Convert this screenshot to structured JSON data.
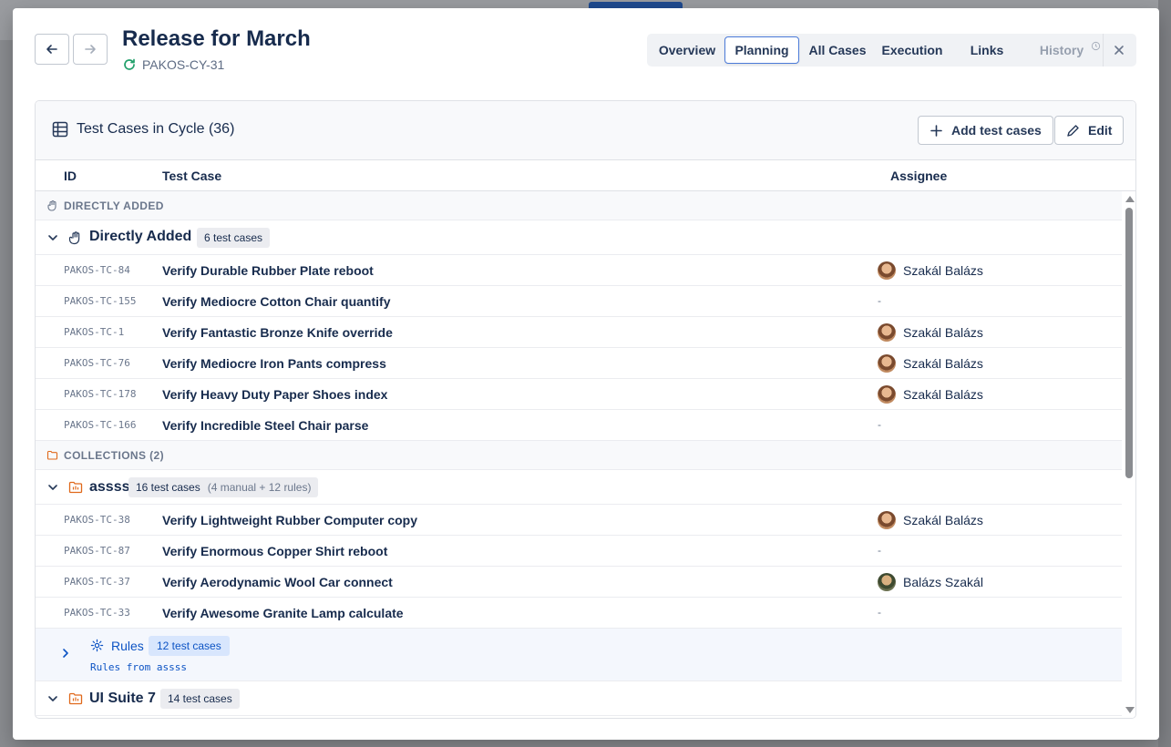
{
  "header": {
    "title": "Release for March",
    "cycle_key": "PAKOS-CY-31"
  },
  "tabs": [
    {
      "label": "Overview",
      "state": "normal"
    },
    {
      "label": "Planning",
      "state": "active"
    },
    {
      "label": "All Cases",
      "state": "normal"
    },
    {
      "label": "Execution",
      "state": "normal"
    },
    {
      "label": "Links",
      "state": "normal"
    },
    {
      "label": "History",
      "state": "disabled"
    }
  ],
  "panel": {
    "title": "Test Cases in Cycle (36)",
    "add_label": "Add test cases",
    "edit_label": "Edit"
  },
  "columns": {
    "id": "ID",
    "name": "Test Case",
    "assignee": "Assignee"
  },
  "sections": {
    "direct": "DIRECTLY ADDED",
    "collections": "COLLECTIONS (2)"
  },
  "direct_group": {
    "name": "Directly Added",
    "badge": "6 test cases",
    "cases": [
      {
        "id": "PAKOS-TC-84",
        "name": "Verify Durable Rubber Plate reboot",
        "assignee": "Szakál Balázs"
      },
      {
        "id": "PAKOS-TC-155",
        "name": "Verify Mediocre Cotton Chair quantify",
        "assignee": "-"
      },
      {
        "id": "PAKOS-TC-1",
        "name": "Verify Fantastic Bronze Knife override",
        "assignee": "Szakál Balázs"
      },
      {
        "id": "PAKOS-TC-76",
        "name": "Verify Mediocre Iron Pants compress",
        "assignee": "Szakál Balázs"
      },
      {
        "id": "PAKOS-TC-178",
        "name": "Verify Heavy Duty Paper Shoes index",
        "assignee": "Szakál Balázs"
      },
      {
        "id": "PAKOS-TC-166",
        "name": "Verify Incredible Steel Chair parse",
        "assignee": "-"
      }
    ]
  },
  "collection_1": {
    "name": "assss",
    "badge": "16 test cases",
    "badge_sub": "(4 manual + 12 rules)",
    "cases": [
      {
        "id": "PAKOS-TC-38",
        "name": "Verify Lightweight Rubber Computer copy",
        "assignee": "Szakál Balázs"
      },
      {
        "id": "PAKOS-TC-87",
        "name": "Verify Enormous Copper Shirt reboot",
        "assignee": "-"
      },
      {
        "id": "PAKOS-TC-37",
        "name": "Verify Aerodynamic Wool Car connect",
        "assignee": "Balázs Szakál"
      },
      {
        "id": "PAKOS-TC-33",
        "name": "Verify Awesome Granite Lamp calculate",
        "assignee": "-"
      }
    ],
    "rules": {
      "label": "Rules",
      "badge": "12 test cases",
      "sub": "Rules from assss"
    }
  },
  "collection_2": {
    "name": "UI Suite 7",
    "badge": "14 test cases"
  },
  "colors": {
    "accent": "#0c53c4",
    "collection_icon": "#e0681a",
    "sync_icon": "#22a06b"
  }
}
